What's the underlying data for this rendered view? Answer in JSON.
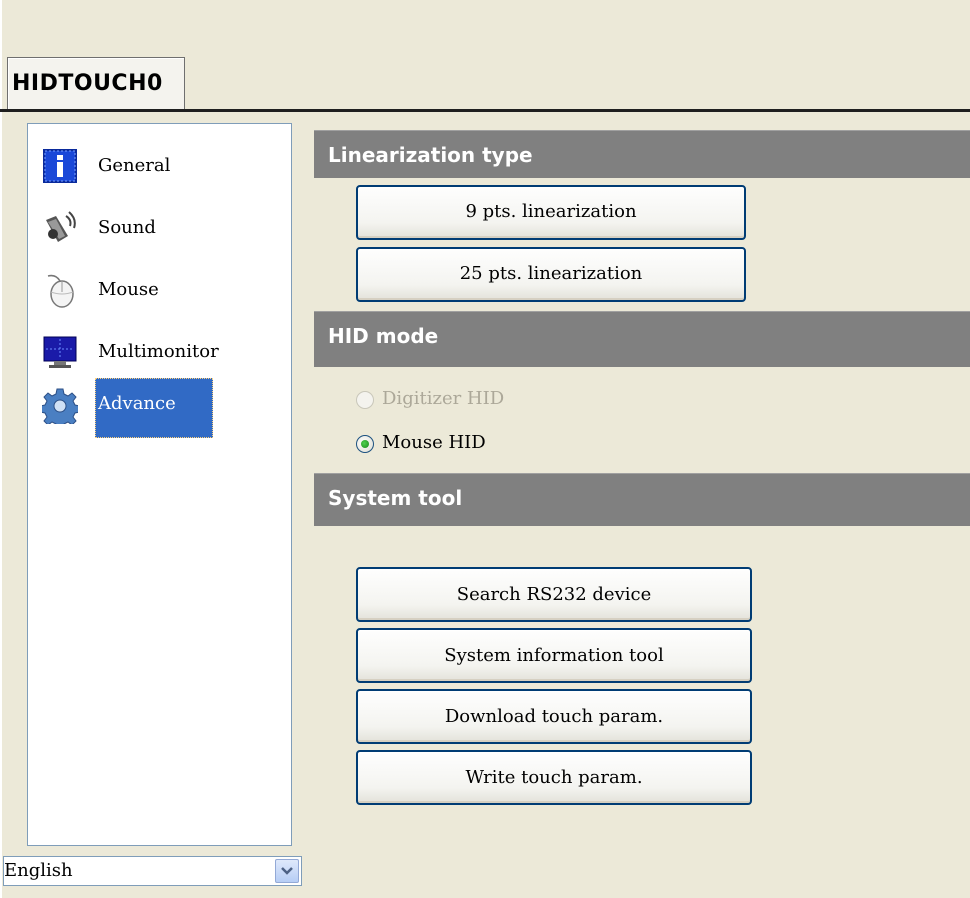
{
  "device_tab": "HIDTOUCH0",
  "sidebar": {
    "items": [
      {
        "label": "General",
        "icon": "info-icon"
      },
      {
        "label": "Sound",
        "icon": "speaker-icon"
      },
      {
        "label": "Mouse",
        "icon": "mouse-icon"
      },
      {
        "label": "Multimonitor",
        "icon": "monitor-icon"
      },
      {
        "label": "Advance",
        "icon": "gear-icon"
      }
    ],
    "selected": "Advance"
  },
  "language": {
    "value": "English"
  },
  "linearization": {
    "header": "Linearization type",
    "buttons": [
      "9 pts. linearization",
      "25 pts. linearization"
    ]
  },
  "hid_mode": {
    "header": "HID mode",
    "options": [
      {
        "label": "Digitizer HID",
        "enabled": false,
        "checked": false
      },
      {
        "label": "Mouse HID",
        "enabled": true,
        "checked": true
      }
    ]
  },
  "system_tool": {
    "header": "System tool",
    "buttons": [
      "Search RS232 device",
      "System information tool",
      "Download touch param.",
      "Write touch param."
    ]
  },
  "colors": {
    "section_header": "#808080",
    "selection": "#316ac5",
    "button_border": "#003c74",
    "background": "#ece9d8"
  }
}
